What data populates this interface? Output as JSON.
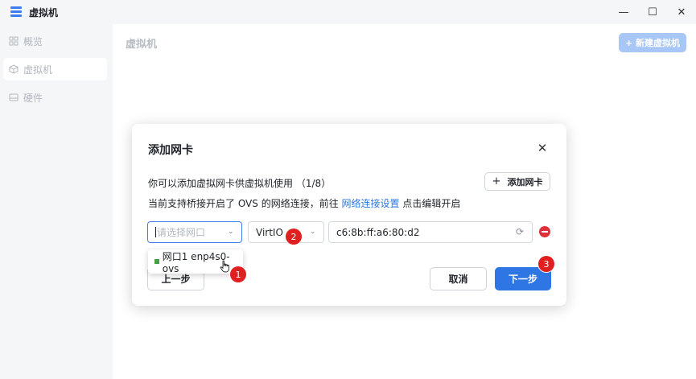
{
  "window": {
    "title": "虚拟机",
    "controls": {
      "minimize": "—",
      "maximize": "☐",
      "close": "✕"
    }
  },
  "sidebar": {
    "items": [
      {
        "label": "概览",
        "icon": "grid-icon"
      },
      {
        "label": "虚拟机",
        "icon": "cube-icon"
      },
      {
        "label": "硬件",
        "icon": "hard-drive-icon"
      }
    ]
  },
  "main": {
    "title": "虚拟机",
    "new_vm_button": "+ 新建虚拟机"
  },
  "dialog": {
    "title": "添加网卡",
    "close_icon": "✕",
    "description": "你可以添加虚拟网卡供虚拟机使用 （1/8）",
    "add_button": {
      "plus": "+",
      "label": "添加网卡"
    },
    "note_prefix": "当前支持桥接开启了 OVS 的网络连接，前往",
    "note_link": "网络连接设置",
    "note_suffix": "点击编辑开启",
    "port_select": {
      "placeholder": "请选择网口",
      "chevron": "⌄"
    },
    "model_select": {
      "value": "VirtIO",
      "chevron": "⌄"
    },
    "mac_input": {
      "value": "c6:8b:ff:a6:80:d2",
      "refresh_icon": "⟳"
    },
    "prev_button": "上一步",
    "cancel_button": "取消",
    "next_button": "下一步"
  },
  "dropdown": {
    "option": "网口1 enp4s0-ovs",
    "status_color": "#43a047"
  },
  "annotations": {
    "badge_1": "1",
    "badge_2": "2",
    "badge_3": "3"
  },
  "colors": {
    "accent": "#2f76e5",
    "danger": "#e0313b",
    "badge": "#e02020"
  }
}
